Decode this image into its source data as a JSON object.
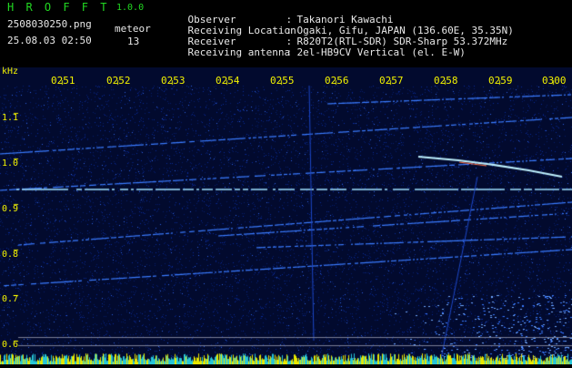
{
  "header": {
    "app_title": "H R O F F T",
    "version": "1.0.0",
    "filename": "2508030250.png",
    "timestamp": "25.08.03 02:50",
    "meteor_label": "meteor",
    "meteor_count": "13"
  },
  "info": [
    {
      "key": "Observer",
      "value": "Takanori Kawachi"
    },
    {
      "key": "Receiving Location",
      "value": "Ogaki, Gifu, JAPAN (136.60E, 35.35N)"
    },
    {
      "key": "Receiver",
      "value": "R820T2(RTL-SDR) SDR-Sharp 53.372MHz"
    },
    {
      "key": "Receiving antenna",
      "value": "2el-HB9CV Vertical (el. E-W)"
    }
  ],
  "spectrogram": {
    "unit_label": "kHz",
    "time_ticks": [
      "0251",
      "0252",
      "0253",
      "0254",
      "0255",
      "0256",
      "0257",
      "0258",
      "0259",
      "0300"
    ],
    "freq_ticks": [
      "1.1",
      "1.0",
      "0.9",
      "0.8",
      "0.7",
      "0.6"
    ],
    "colors": {
      "background": "#020a2e",
      "noise": "#0a2a9a",
      "trace": "#3a7bff",
      "carrier": "#9fe0ff",
      "axis": "#f2f200"
    }
  }
}
